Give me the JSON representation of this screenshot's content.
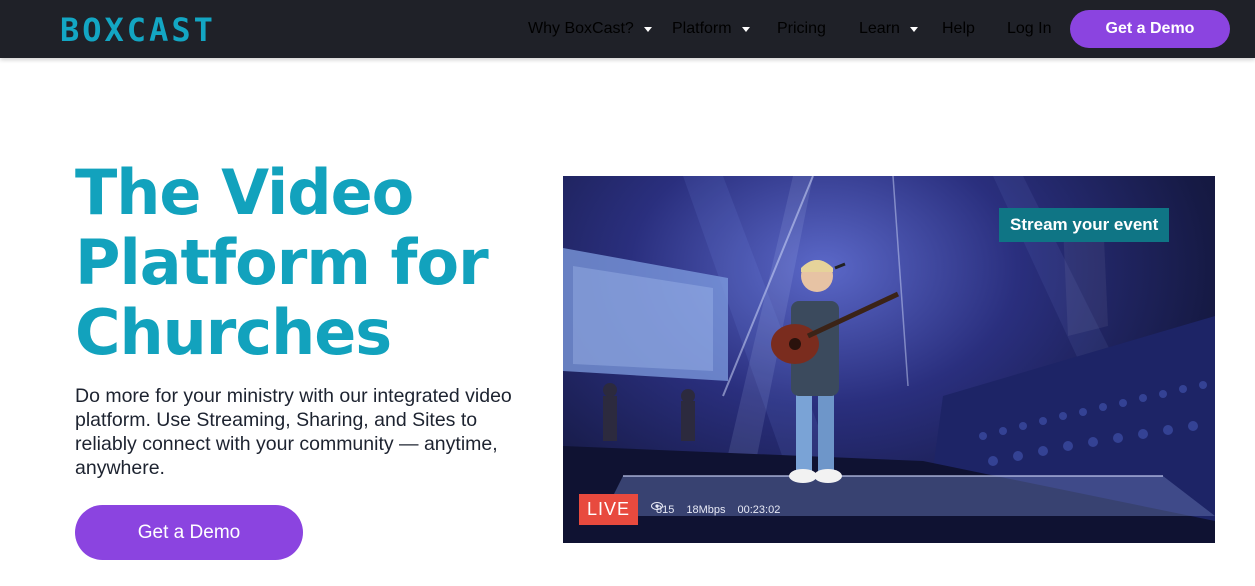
{
  "header": {
    "logo": "BOXCAST",
    "nav": [
      {
        "label": "Why BoxCast?",
        "dropdown": true
      },
      {
        "label": "Platform",
        "dropdown": true
      },
      {
        "label": "Pricing",
        "dropdown": false
      },
      {
        "label": "Learn",
        "dropdown": true
      },
      {
        "label": "Help",
        "dropdown": false
      },
      {
        "label": "Log In",
        "dropdown": false
      }
    ],
    "cta_label": "Get a Demo"
  },
  "hero": {
    "title_lines": [
      "The Video",
      "Platform for",
      "Churches"
    ],
    "description": "Do more for your ministry with our integrated video platform. Use Streaming, Sharing, and Sites to reliably connect with your community — anytime, anywhere.",
    "cta_label": "Get a Demo"
  },
  "video": {
    "badge": "Stream your event",
    "live_label": "LIVE",
    "viewers": "815",
    "bitrate": "18Mbps",
    "duration": "00:23:02"
  },
  "colors": {
    "header_bg": "#1f2128",
    "brand_teal": "#13a6c3",
    "cta_purple": "#8b44e0",
    "live_red": "#e84a3e",
    "badge_teal": "#0f7585"
  }
}
